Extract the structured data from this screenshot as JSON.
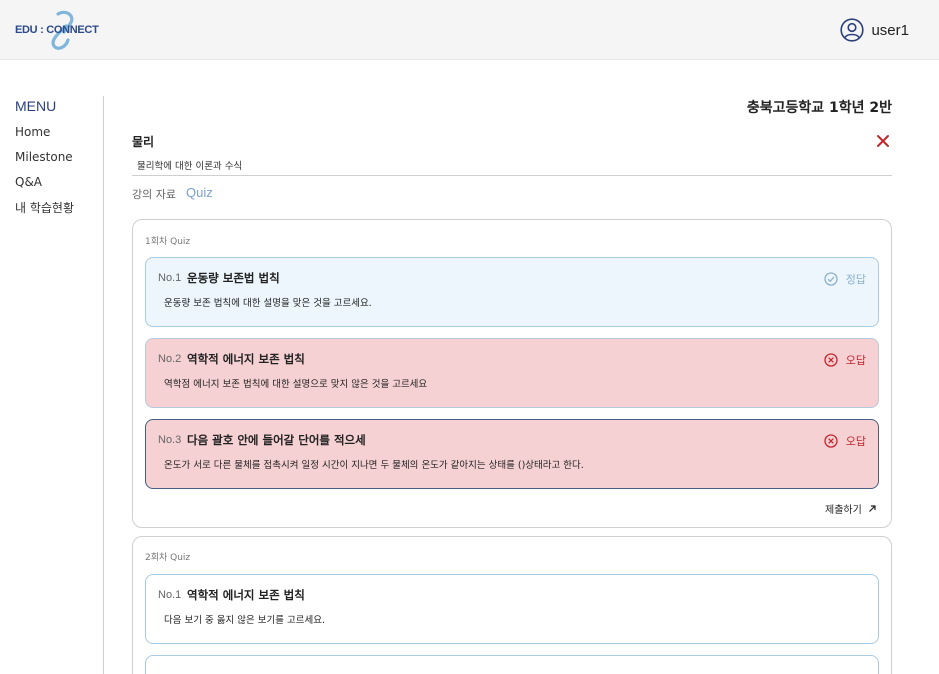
{
  "header": {
    "logo_text": "EDU : CONNECT",
    "username": "user1"
  },
  "sidebar": {
    "title": "MENU",
    "items": [
      {
        "label": "Home"
      },
      {
        "label": "Milestone"
      },
      {
        "label": "Q&A"
      },
      {
        "label": "내 학습현황"
      }
    ]
  },
  "page": {
    "school": "충북고등학교 1학년 2반",
    "subject": "물리",
    "description": "물리학에 대한 이론과 수식",
    "tabs": [
      {
        "label": "강의 자료"
      },
      {
        "label": "Quiz"
      }
    ]
  },
  "rounds": [
    {
      "title": "1회차 Quiz",
      "questions": [
        {
          "no": "No.1",
          "title": "운동량 보존법 법칙",
          "text": "운동량 보존 법칙에 대한 설명을 맞은 것을 고르세요.",
          "status": "정답",
          "state": "correct"
        },
        {
          "no": "No.2",
          "title": "역학적 에너지 보존 법칙",
          "text": "역학점 에너지 보존 법칙에 대한 설명으로 맞지 않은 것을 고르세요",
          "status": "오답",
          "state": "wrong"
        },
        {
          "no": "No.3",
          "title": "다음 괄호 안에 들어갈 단어를 적으세",
          "text": "온도가 서로 다른 물체를 접촉시켜 일정 시간이 지나면 두 물체의 온도가 같아지는 상태를 ()상태라고 한다.",
          "status": "오답",
          "state": "wrong"
        }
      ],
      "submit_label": "제출하기"
    },
    {
      "title": "2회차 Quiz",
      "questions": [
        {
          "no": "No.1",
          "title": "역학적 에너지 보존 법칙",
          "text": "다음 보기 중 옳지 않은 보기를 고르세요."
        }
      ]
    }
  ],
  "colors": {
    "accent": "#2b4a8b",
    "correct": "#8cb0cc",
    "wrong": "#c1272d",
    "wrong_bg": "#f6d1d3",
    "correct_bg": "#ecf6fc"
  }
}
